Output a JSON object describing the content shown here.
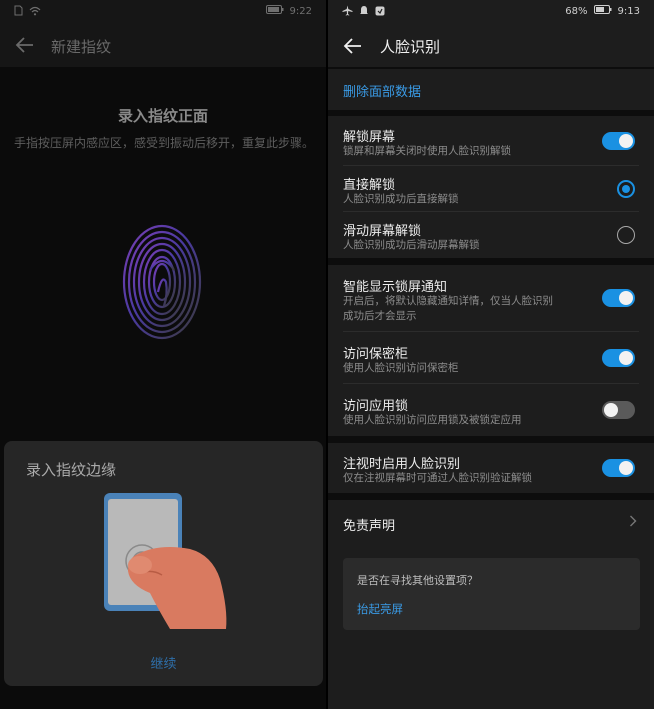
{
  "left": {
    "status": {
      "time": "9:22"
    },
    "title": "新建指纹",
    "enroll_title": "录入指纹正面",
    "enroll_desc": "手指按压屏内感应区，感受到振动后移开，重复此步骤。",
    "sheet_title": "录入指纹边缘",
    "continue_label": "继续"
  },
  "right": {
    "status": {
      "battery": "68%",
      "time": "9:13"
    },
    "title": "人脸识别",
    "delete_label": "删除面部数据",
    "unlock_screen": {
      "title": "解锁屏幕",
      "subtitle": "锁屏和屏幕关闭时使用人脸识别解锁",
      "on": true
    },
    "direct_unlock": {
      "title": "直接解锁",
      "subtitle": "人脸识别成功后直接解锁",
      "selected": true
    },
    "slide_unlock": {
      "title": "滑动屏幕解锁",
      "subtitle": "人脸识别成功后滑动屏幕解锁",
      "selected": false
    },
    "smart_notif": {
      "title": "智能显示锁屏通知",
      "subtitle_line1": "开启后，将默认隐藏通知详情，仅当人脸识别",
      "subtitle_line2": "成功后才会显示",
      "on": true
    },
    "safe": {
      "title": "访问保密柜",
      "subtitle": "使用人脸识别访问保密柜",
      "on": true
    },
    "app_lock": {
      "title": "访问应用锁",
      "subtitle": "使用人脸识别访问应用锁及被锁定应用",
      "on": false
    },
    "gaze": {
      "title": "注视时启用人脸识别",
      "subtitle": "仅在注视屏幕时可通过人脸识别验证解锁",
      "on": true
    },
    "disclaimer": "免责声明",
    "tip_question": "是否在寻找其他设置项？",
    "tip_link": "抬起亮屏"
  },
  "colors": {
    "accent": "#1a91e2",
    "link": "#3a9be6"
  }
}
